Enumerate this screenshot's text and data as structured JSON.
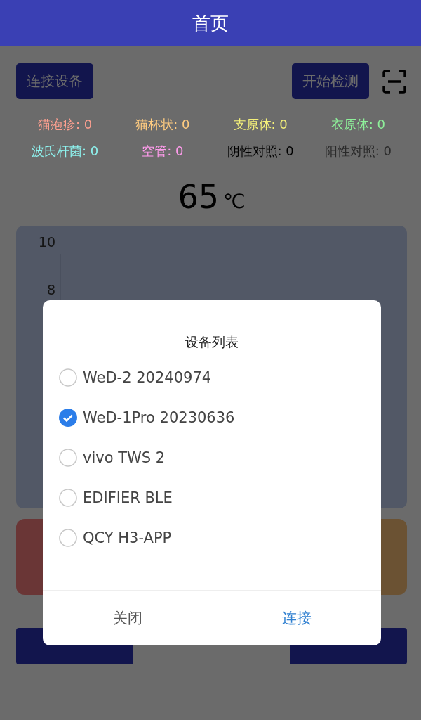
{
  "header": {
    "title": "首页"
  },
  "actions": {
    "connect_button": "连接设备",
    "start_button": "开始检测"
  },
  "counters": [
    {
      "label": "猫疱疹: 0",
      "color": "#ffa090"
    },
    {
      "label": "猫杯状: 0",
      "color": "#ffcc80"
    },
    {
      "label": "支原体: 0",
      "color": "#f4f07a"
    },
    {
      "label": "衣原体: 0",
      "color": "#8ef09a"
    },
    {
      "label": "波氏杆菌: 0",
      "color": "#8ef2ee"
    },
    {
      "label": "空管: 0",
      "color": "#ff9cec"
    },
    {
      "label": "阴性对照: 0",
      "color": "#000000"
    },
    {
      "label": "阳性对照: 0",
      "color": "#2a2a2a"
    }
  ],
  "temperature": {
    "value": "65",
    "unit": "℃"
  },
  "chart": {
    "ytick_labels": [
      "10",
      "8"
    ]
  },
  "dialog": {
    "title": "设备列表",
    "devices": [
      {
        "name": "WeD-2 20240974",
        "selected": false
      },
      {
        "name": "WeD-1Pro 20230636",
        "selected": true
      },
      {
        "name": "vivo TWS 2",
        "selected": false
      },
      {
        "name": "EDIFIER BLE",
        "selected": false
      },
      {
        "name": "QCY H3-APP",
        "selected": false
      }
    ],
    "buttons": [
      {
        "label": "关闭",
        "kind": "cancel"
      },
      {
        "label": "连接",
        "kind": "confirm"
      }
    ]
  }
}
